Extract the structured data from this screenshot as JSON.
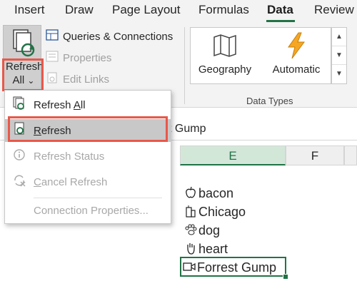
{
  "tabs": [
    "Insert",
    "Draw",
    "Page Layout",
    "Formulas",
    "Data",
    "Review"
  ],
  "active_tab": "Data",
  "accent_color": "#217346",
  "highlight_color": "#e8584a",
  "ribbon": {
    "refresh_label_line1": "Refresh",
    "refresh_label_line2": "All",
    "refresh_caret": "⌄",
    "queries_connections": "Queries & Connections",
    "properties": "Properties",
    "edit_links": "Edit Links",
    "geography": "Geography",
    "automatic": "Automatic",
    "group_label": "Data Types"
  },
  "menu": {
    "refresh_all": "Refresh All",
    "refresh_all_key": "A",
    "refresh": "Refresh",
    "refresh_key": "R",
    "refresh_status": "Refresh Status",
    "cancel_refresh": "Cancel Refresh",
    "connection_properties": "Connection Properties..."
  },
  "formula_bar": {
    "value": "t Gump"
  },
  "columns": [
    "E",
    "F"
  ],
  "cells": [
    {
      "icon": "apple-icon",
      "text": "bacon"
    },
    {
      "icon": "building-icon",
      "text": "Chicago"
    },
    {
      "icon": "paw-icon",
      "text": "dog"
    },
    {
      "icon": "hand-icon",
      "text": "heart"
    },
    {
      "icon": "video-camera-icon",
      "text": "Forrest Gump"
    }
  ]
}
